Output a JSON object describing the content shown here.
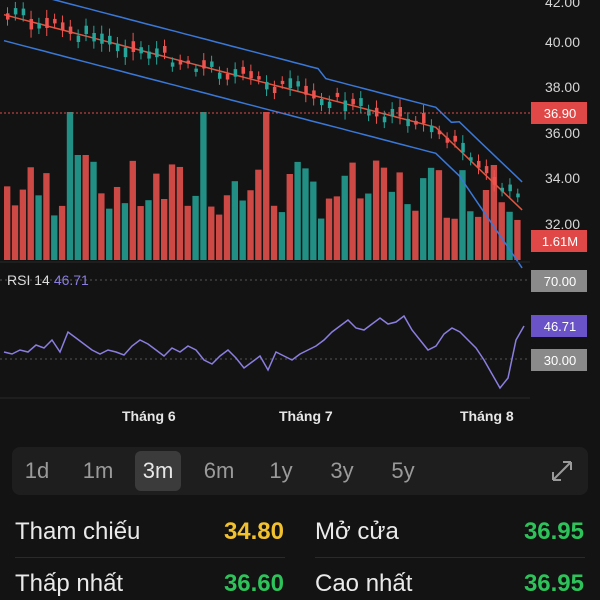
{
  "price_axis": {
    "ticks": [
      "42.00",
      "40.00",
      "38.00",
      "36.00",
      "34.00",
      "32.00"
    ]
  },
  "current_price": "36.90",
  "current_volume": "1.61M",
  "rsi": {
    "label": "RSI 14",
    "value": "46.71",
    "ticks": [
      "70.00",
      "30.00"
    ],
    "line_color": "#8a7ee0"
  },
  "months": [
    "Tháng 6",
    "Tháng 7",
    "Tháng 8"
  ],
  "ranges": [
    {
      "label": "1d",
      "active": false
    },
    {
      "label": "1m",
      "active": false
    },
    {
      "label": "3m",
      "active": true
    },
    {
      "label": "6m",
      "active": false
    },
    {
      "label": "1y",
      "active": false
    },
    {
      "label": "3y",
      "active": false
    },
    {
      "label": "5y",
      "active": false
    }
  ],
  "stats": [
    {
      "label": "Tham chiếu",
      "value": "34.80",
      "color": "#f2c12e"
    },
    {
      "label": "Mở cửa",
      "value": "36.95",
      "color": "#2ec35a"
    },
    {
      "label": "Thấp nhất",
      "value": "36.60",
      "color": "#2ec35a"
    },
    {
      "label": "Cao nhất",
      "value": "36.95",
      "color": "#2ec35a"
    }
  ],
  "colors": {
    "up": "#26a69a",
    "down": "#ef5350",
    "badge": "#e04848"
  },
  "icons": {
    "expand": "expand-diagonal-icon"
  }
}
